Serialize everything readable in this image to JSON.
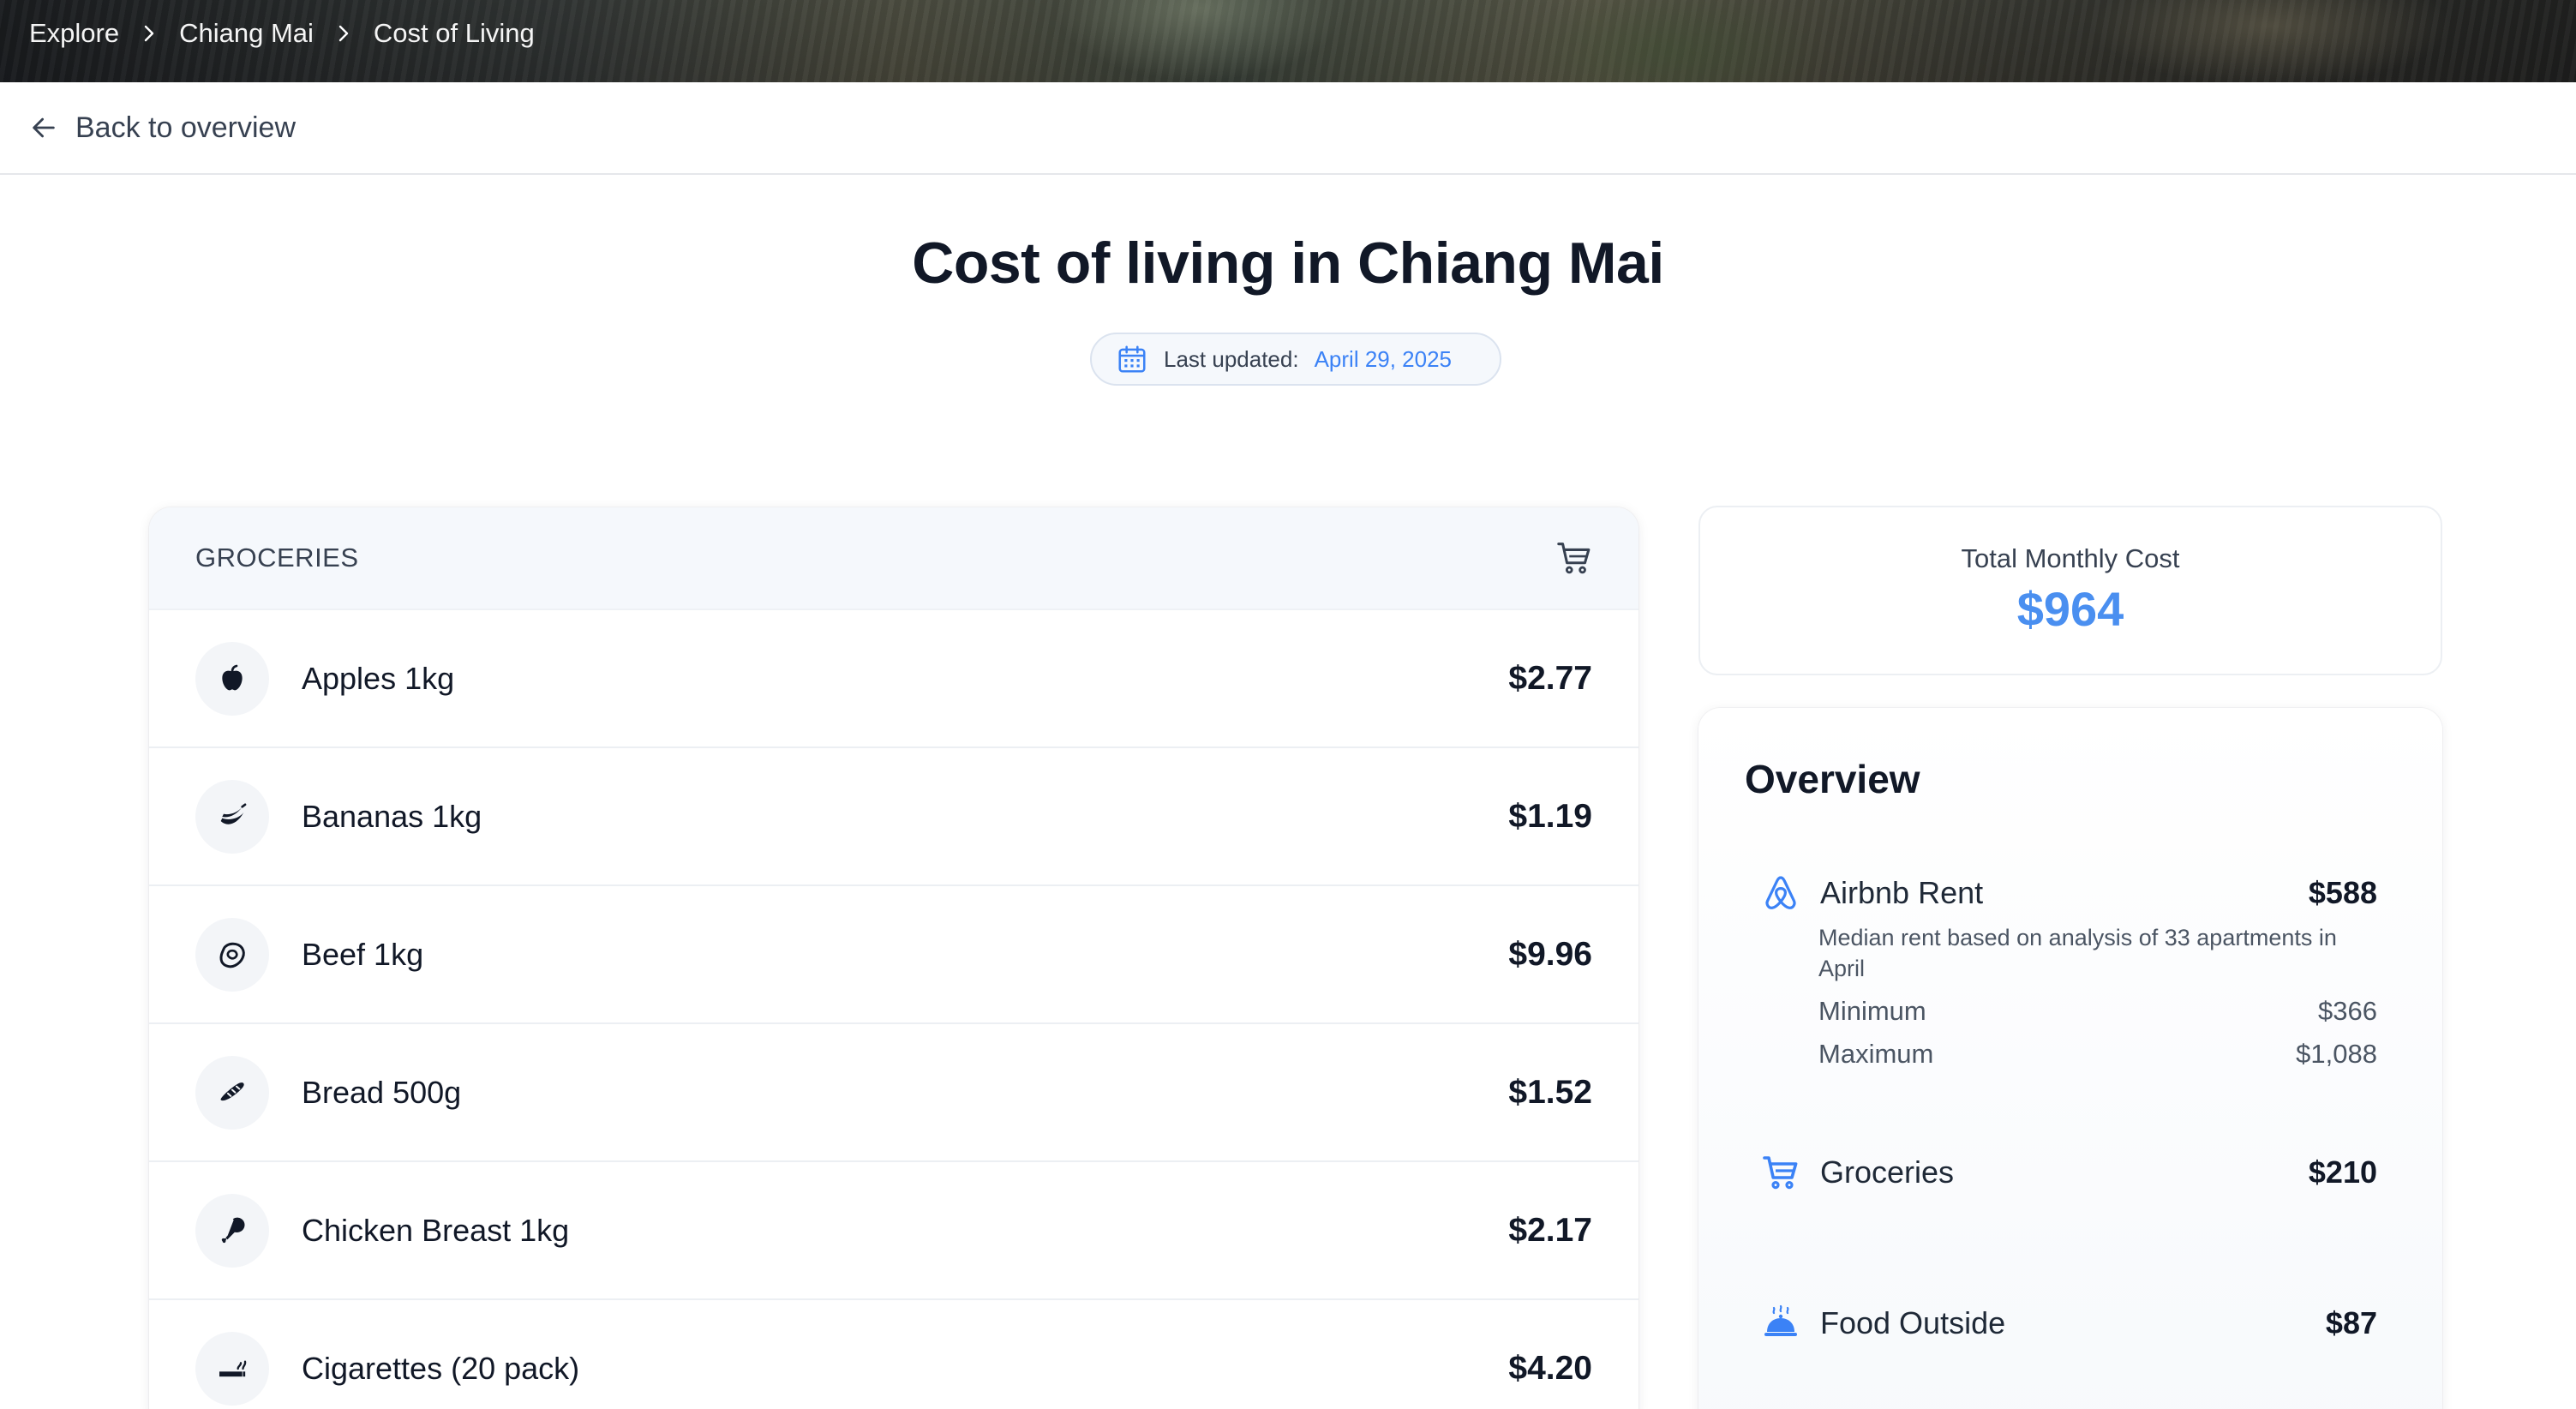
{
  "breadcrumb": {
    "items": [
      "Explore",
      "Chiang Mai",
      "Cost of Living"
    ]
  },
  "back_link": {
    "label": "Back to overview"
  },
  "page": {
    "title": "Cost of living in Chiang Mai",
    "updated_label": "Last updated:",
    "updated_date": "April 29, 2025"
  },
  "groceries": {
    "title": "GROCERIES",
    "items": [
      {
        "name": "Apples 1kg",
        "price": "$2.77",
        "icon": "apple-icon"
      },
      {
        "name": "Bananas 1kg",
        "price": "$1.19",
        "icon": "banana-icon"
      },
      {
        "name": "Beef 1kg",
        "price": "$9.96",
        "icon": "beef-icon"
      },
      {
        "name": "Bread 500g",
        "price": "$1.52",
        "icon": "bread-icon"
      },
      {
        "name": "Chicken Breast 1kg",
        "price": "$2.17",
        "icon": "drumstick-icon"
      },
      {
        "name": "Cigarettes (20 pack)",
        "price": "$4.20",
        "icon": "cigarette-icon"
      }
    ]
  },
  "total": {
    "label": "Total Monthly Cost",
    "value": "$964"
  },
  "overview": {
    "title": "Overview",
    "rent": {
      "label": "Airbnb Rent",
      "amount": "$588",
      "description": "Median rent based on analysis of 33 apartments in April",
      "min_label": "Minimum",
      "min_value": "$366",
      "max_label": "Maximum",
      "max_value": "$1,088"
    },
    "groceries": {
      "label": "Groceries",
      "amount": "$210"
    },
    "food_outside": {
      "label": "Food Outside",
      "amount": "$87"
    }
  },
  "colors": {
    "accent": "#4a8ff0",
    "link_blue": "#3b82f6",
    "icon_blue": "#3b82f6"
  }
}
